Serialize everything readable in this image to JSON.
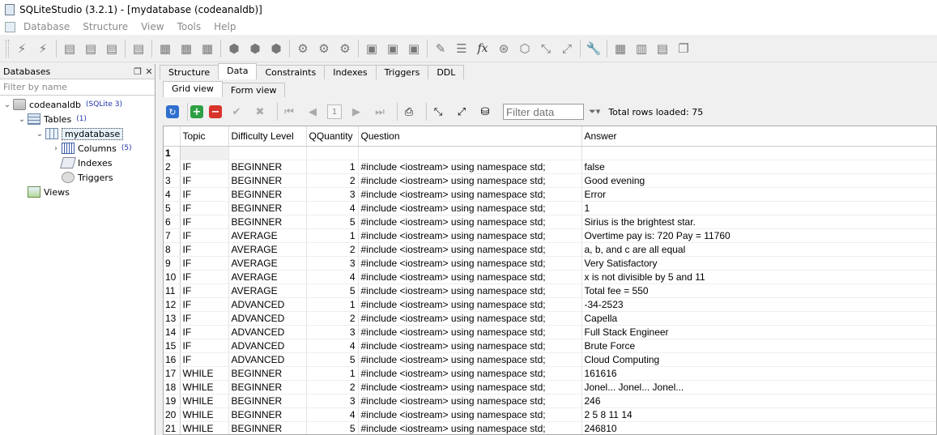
{
  "window": {
    "title": "SQLiteStudio (3.2.1) - [mydatabase (codeanaldb)]"
  },
  "menu": {
    "items": [
      "Database",
      "Structure",
      "View",
      "Tools",
      "Help"
    ]
  },
  "db_panel": {
    "title": "Databases",
    "filter_placeholder": "Filter by name",
    "database": {
      "name": "codeanaldb",
      "badge": "(SQLite 3)"
    },
    "tables": {
      "label": "Tables",
      "count": "(1)"
    },
    "table": {
      "name": "mydatabase"
    },
    "columns": {
      "label": "Columns",
      "count": "(5)"
    },
    "indexes": {
      "label": "Indexes"
    },
    "triggers": {
      "label": "Triggers"
    },
    "views": {
      "label": "Views"
    }
  },
  "tabs": [
    "Structure",
    "Data",
    "Constraints",
    "Indexes",
    "Triggers",
    "DDL"
  ],
  "subtabs": [
    "Grid view",
    "Form view"
  ],
  "grid_toolbar": {
    "page": "1",
    "filter_placeholder": "Filter data",
    "rows_loaded": "Total rows loaded: 75"
  },
  "grid": {
    "columns": [
      "Topic",
      "Difficulty Level",
      "QQuantity",
      "Question",
      "Answer"
    ],
    "rows": [
      [
        "1",
        "",
        "",
        "",
        "",
        ""
      ],
      [
        "2",
        "IF",
        "BEGINNER",
        "1",
        "#include <iostream> using namespace std;",
        "false"
      ],
      [
        "3",
        "IF",
        "BEGINNER",
        "2",
        "#include <iostream> using namespace std;",
        "Good evening"
      ],
      [
        "4",
        "IF",
        "BEGINNER",
        "3",
        "#include <iostream> using namespace std;",
        "Error"
      ],
      [
        "5",
        "IF",
        "BEGINNER",
        "4",
        "#include <iostream> using namespace std;",
        "1"
      ],
      [
        "6",
        "IF",
        "BEGINNER",
        "5",
        "#include <iostream> using namespace std;",
        "Sirius is the brightest star."
      ],
      [
        "7",
        "IF",
        "AVERAGE",
        "1",
        "#include <iostream> using namespace std;",
        "Overtime pay is: 720 Pay = 11760"
      ],
      [
        "8",
        "IF",
        "AVERAGE",
        "2",
        "#include <iostream> using namespace std;",
        "a, b, and c are all equal"
      ],
      [
        "9",
        "IF",
        "AVERAGE",
        "3",
        "#include <iostream> using namespace std;",
        "Very Satisfactory"
      ],
      [
        "10",
        "IF",
        "AVERAGE",
        "4",
        "#include <iostream> using namespace std;",
        "x is not divisible by 5 and 11"
      ],
      [
        "11",
        "IF",
        "AVERAGE",
        "5",
        "#include <iostream> using namespace std;",
        "Total fee = 550"
      ],
      [
        "12",
        "IF",
        "ADVANCED",
        "1",
        "#include <iostream> using namespace std;",
        "-34-2523"
      ],
      [
        "13",
        "IF",
        "ADVANCED",
        "2",
        "#include <iostream> using namespace std;",
        "Capella"
      ],
      [
        "14",
        "IF",
        "ADVANCED",
        "3",
        "#include <iostream> using namespace std;",
        "Full Stack Engineer"
      ],
      [
        "15",
        "IF",
        "ADVANCED",
        "4",
        "#include <iostream> using namespace std;",
        "Brute Force"
      ],
      [
        "16",
        "IF",
        "ADVANCED",
        "5",
        "#include <iostream> using namespace std;",
        "Cloud Computing"
      ],
      [
        "17",
        "WHILE",
        "BEGINNER",
        "1",
        "#include <iostream> using namespace std;",
        "161616"
      ],
      [
        "18",
        "WHILE",
        "BEGINNER",
        "2",
        "#include <iostream> using namespace std;",
        "Jonel... Jonel... Jonel..."
      ],
      [
        "19",
        "WHILE",
        "BEGINNER",
        "3",
        "#include <iostream> using namespace std;",
        "246"
      ],
      [
        "20",
        "WHILE",
        "BEGINNER",
        "4",
        "#include <iostream> using namespace std;",
        "2 5 8 11 14"
      ],
      [
        "21",
        "WHILE",
        "BEGINNER",
        "5",
        "#include <iostream> using namespace std;",
        "246810"
      ]
    ]
  }
}
